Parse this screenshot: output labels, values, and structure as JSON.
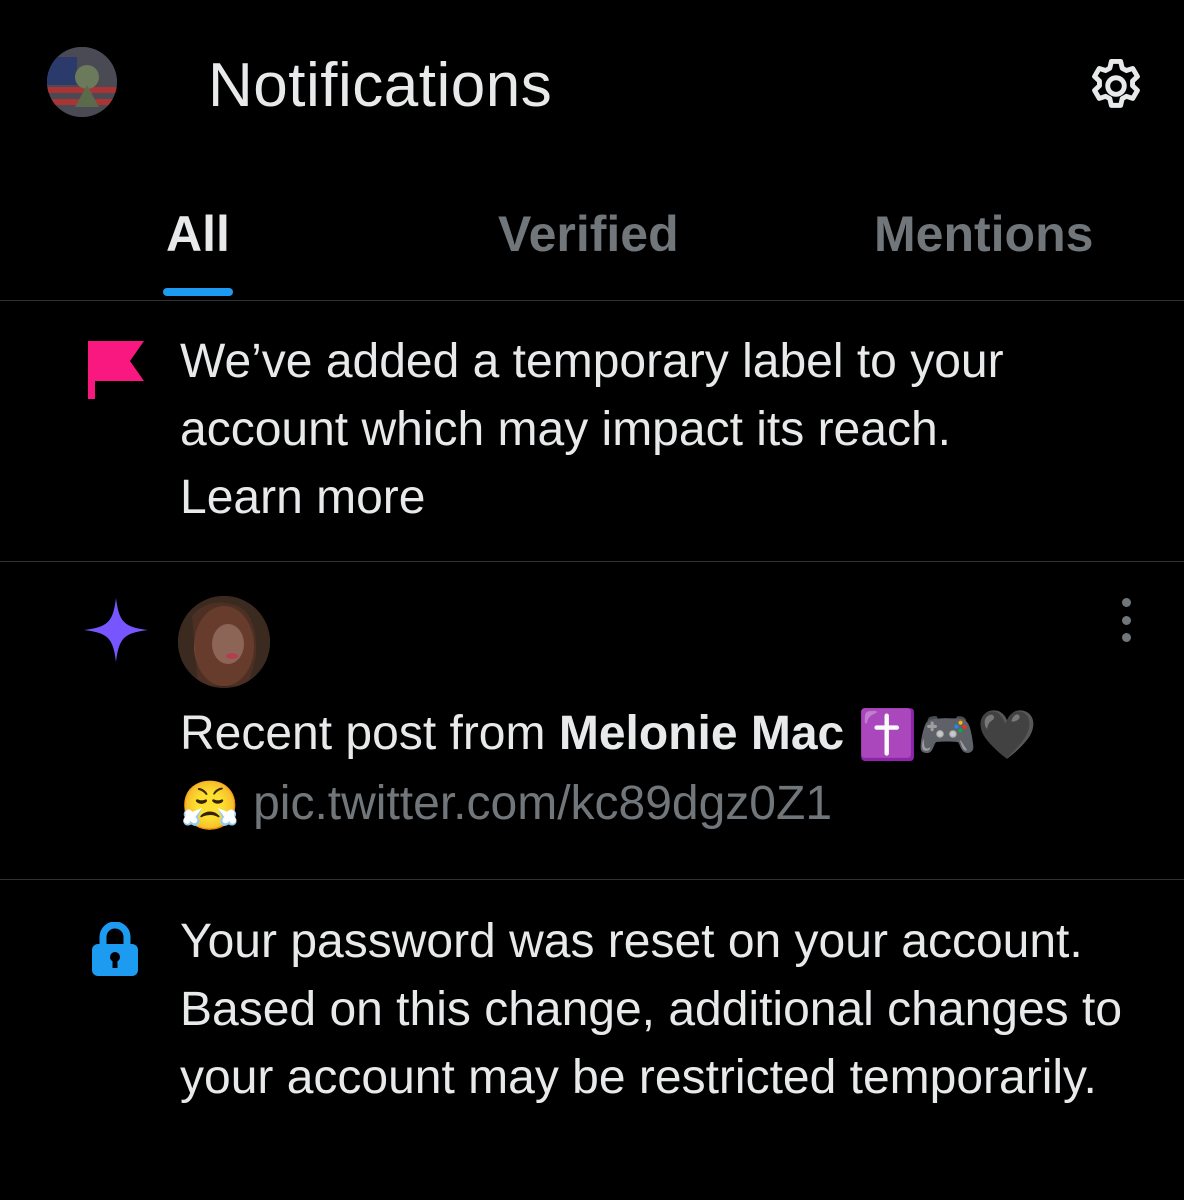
{
  "header": {
    "title": "Notifications"
  },
  "tabs": [
    {
      "label": "All",
      "active": true
    },
    {
      "label": "Verified",
      "active": false
    },
    {
      "label": "Mentions",
      "active": false
    }
  ],
  "notifications": [
    {
      "type": "label-warning",
      "icon": "flag-icon",
      "icon_color": "#f91880",
      "text": "We’ve added a temporary label to your account which may impact its reach.",
      "link": "Learn more"
    },
    {
      "type": "recent-post",
      "icon": "sparkle-icon",
      "icon_color": "#7856ff",
      "prefix": "Recent post from ",
      "author": "Melonie Mac",
      "author_emojis": "✝️🎮🖤",
      "body_emoji": "😤",
      "link_text": "pic.twitter.com/kc89dgz0Z1"
    },
    {
      "type": "security",
      "icon": "lock-icon",
      "icon_color": "#1d9bf0",
      "text": "Your password was reset on your account. Based on this change, additional changes to your account may be restricted temporarily."
    }
  ],
  "colors": {
    "background": "#000000",
    "text_primary": "#e7e9ea",
    "text_secondary": "#71767b",
    "accent": "#1d9bf0",
    "divider": "#2f3336"
  }
}
